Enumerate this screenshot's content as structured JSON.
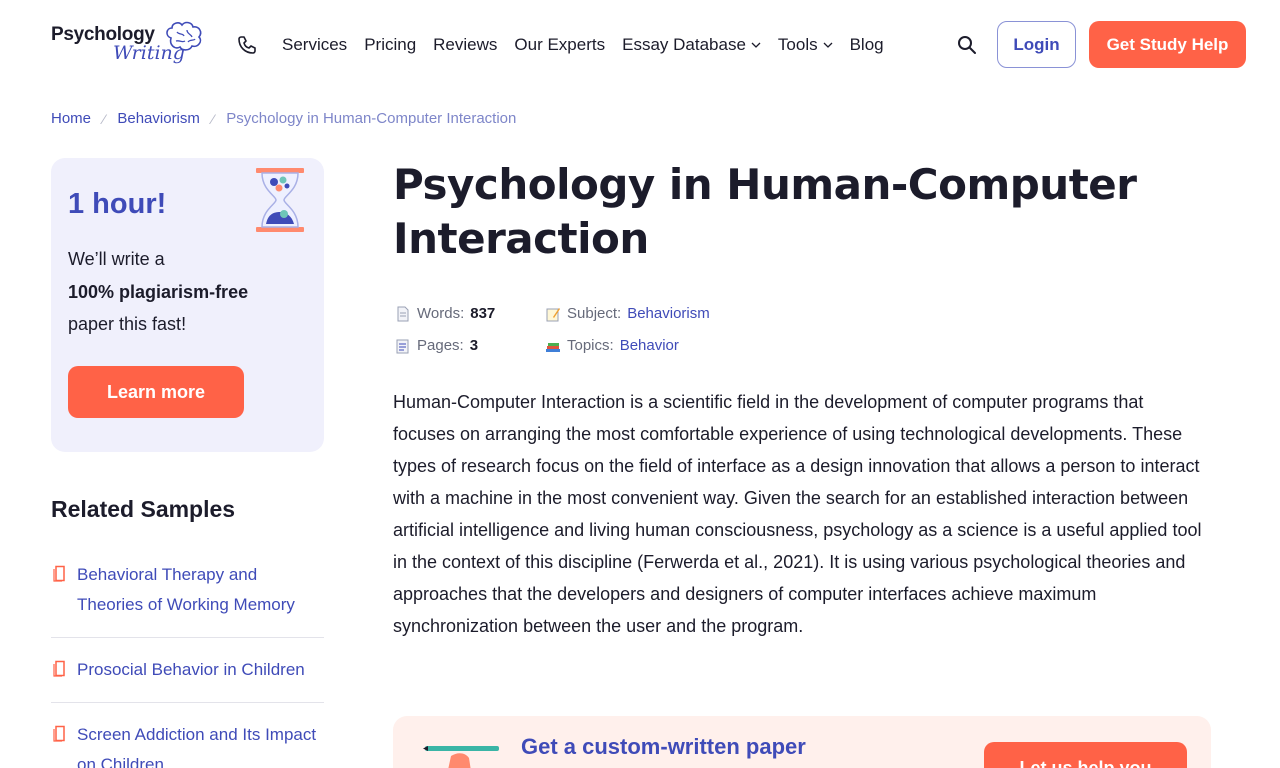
{
  "header": {
    "logo_top": "Psychology",
    "logo_bottom": "Writing",
    "nav": [
      {
        "label": "Services",
        "dropdown": false
      },
      {
        "label": "Pricing",
        "dropdown": false
      },
      {
        "label": "Reviews",
        "dropdown": false
      },
      {
        "label": "Our Experts",
        "dropdown": false
      },
      {
        "label": "Essay Database",
        "dropdown": true
      },
      {
        "label": "Tools",
        "dropdown": true
      },
      {
        "label": "Blog",
        "dropdown": false
      }
    ],
    "login_label": "Login",
    "help_label": "Get Study Help"
  },
  "breadcrumb": {
    "home": "Home",
    "category": "Behaviorism",
    "current": "Psychology in Human-Computer Interaction"
  },
  "promo": {
    "title": "1 hour!",
    "line1": "We’ll write a",
    "line2": "100% plagiarism-free",
    "line3": "paper this fast!",
    "button": "Learn more"
  },
  "related": {
    "title": "Related Samples",
    "items": [
      "Behavioral Therapy and Theories of Working Memory",
      "Prosocial Behavior in Children",
      "Screen Addiction and Its Impact on Children"
    ]
  },
  "article": {
    "title": "Psychology in Human-Computer Interaction",
    "meta": {
      "words_label": "Words:",
      "words_value": "837",
      "pages_label": "Pages:",
      "pages_value": "3",
      "subject_label": "Subject:",
      "subject_value": "Behaviorism",
      "topics_label": "Topics:",
      "topics_value": "Behavior"
    },
    "body": "Human-Computer Interaction is a scientific field in the development of computer programs that focuses on arranging the most comfortable experience of using technological developments. These types of research focus on the field of interface as a design innovation that allows a person to interact with a machine in the most convenient way. Given the search for an established interaction between artificial intelligence and living human consciousness, psychology as a science is a useful applied tool in the context of this discipline (Ferwerda et al., 2021). It is using various psychological theories and approaches that the developers and designers of computer interfaces achieve maximum synchronization between the user and the program."
  },
  "cta": {
    "title": "Get a custom-written paper",
    "button": "Let us help you"
  },
  "colors": {
    "accent": "#ff6247",
    "brand": "#3f4bb8",
    "promo_bg": "#f0f0fc",
    "cta_bg": "#fff0ec"
  }
}
